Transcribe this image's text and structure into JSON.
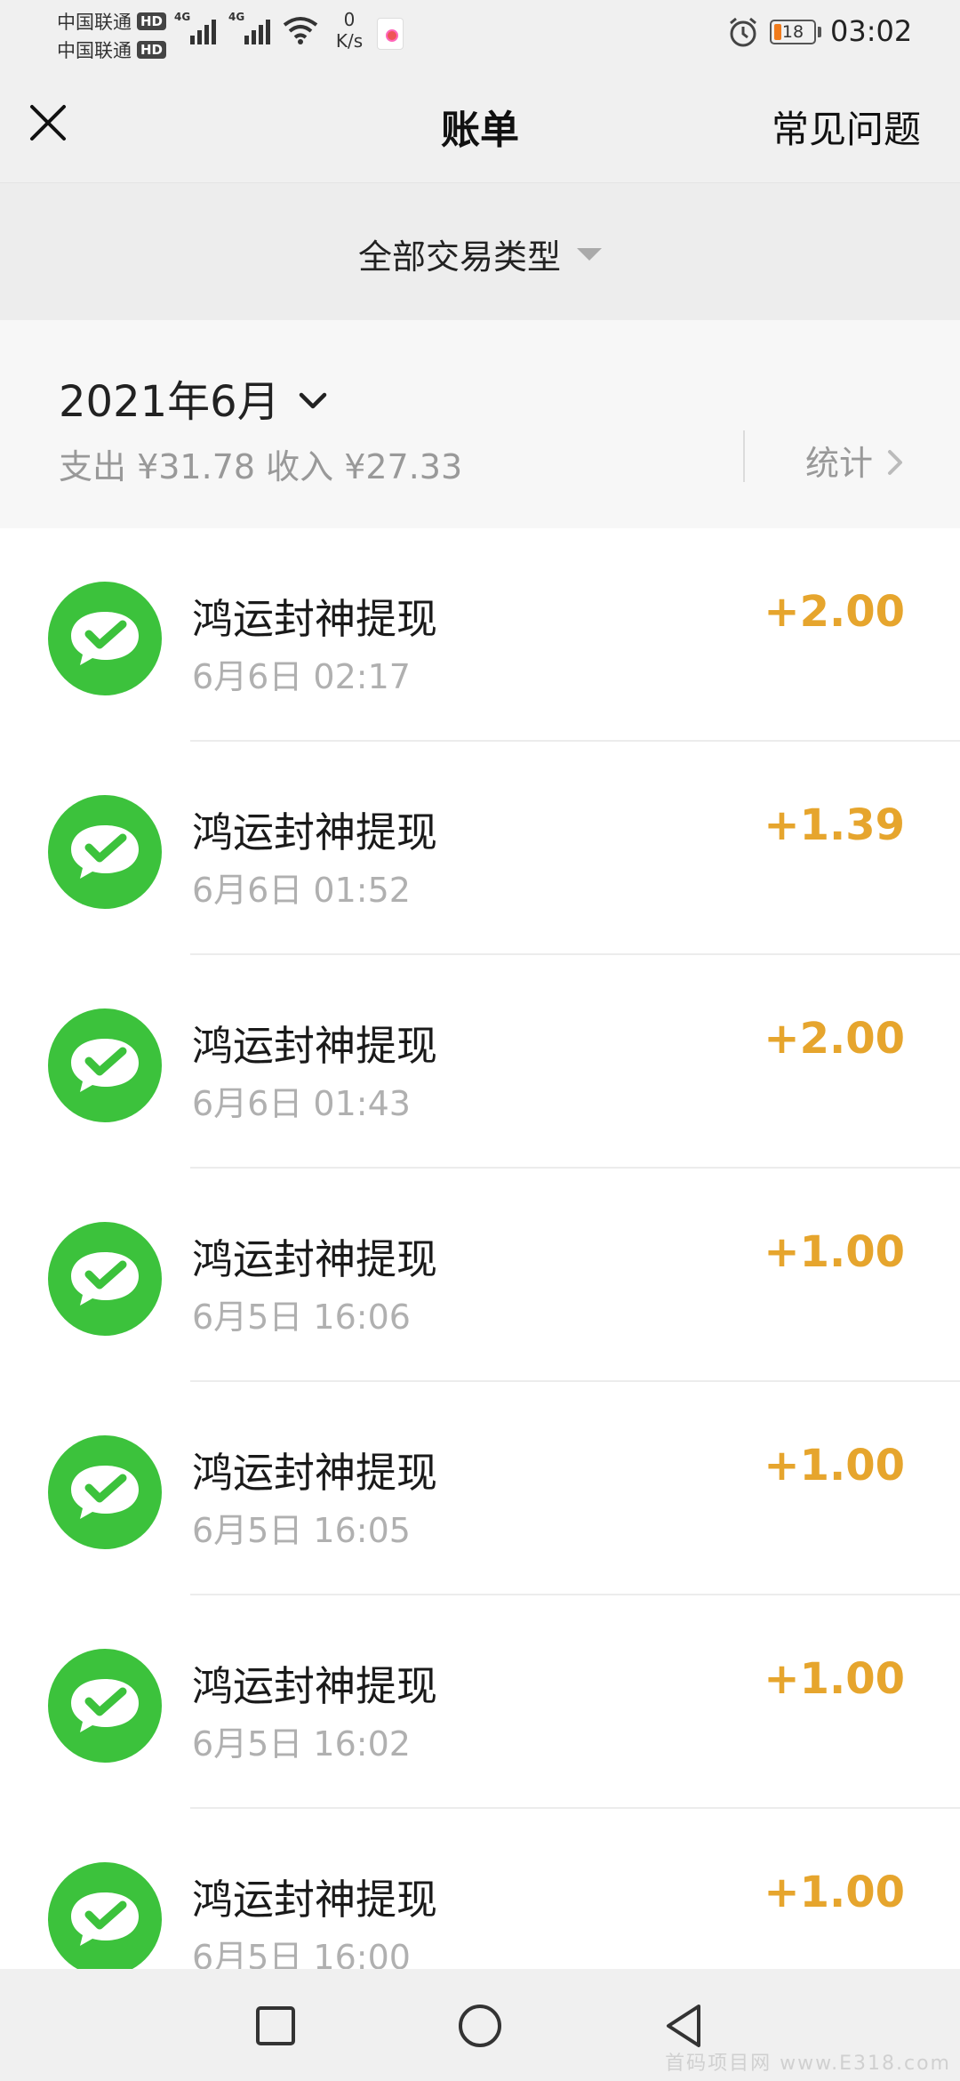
{
  "status_bar": {
    "carrier_1": "中国联通",
    "carrier_2": "中国联通",
    "hd_badge": "HD",
    "network_type": "4G",
    "net_speed_value": "0",
    "net_speed_unit": "K/s",
    "battery_level": "18",
    "battery_color": "#f07b1c",
    "time": "03:02"
  },
  "nav": {
    "title": "账单",
    "faq_label": "常见问题"
  },
  "filter": {
    "label": "全部交易类型"
  },
  "month": {
    "label": "2021年6月",
    "summary": "支出 ¥31.78 收入 ¥27.33",
    "stats_label": "统计"
  },
  "transactions": [
    {
      "title": "鸿运封神提现",
      "time": "6月6日 02:17",
      "amount": "+2.00",
      "icon": "wechat-pay-icon"
    },
    {
      "title": "鸿运封神提现",
      "time": "6月6日 01:52",
      "amount": "+1.39",
      "icon": "wechat-pay-icon"
    },
    {
      "title": "鸿运封神提现",
      "time": "6月6日 01:43",
      "amount": "+2.00",
      "icon": "wechat-pay-icon"
    },
    {
      "title": "鸿运封神提现",
      "time": "6月5日 16:06",
      "amount": "+1.00",
      "icon": "wechat-pay-icon"
    },
    {
      "title": "鸿运封神提现",
      "time": "6月5日 16:05",
      "amount": "+1.00",
      "icon": "wechat-pay-icon"
    },
    {
      "title": "鸿运封神提现",
      "time": "6月5日 16:02",
      "amount": "+1.00",
      "icon": "wechat-pay-icon"
    },
    {
      "title": "鸿运封神提现",
      "time": "6月5日 16:00",
      "amount": "+1.00",
      "icon": "wechat-pay-icon"
    }
  ],
  "colors": {
    "income_amount": "#e6a52d",
    "wechat_green": "#3cc23c"
  },
  "watermark": "首码项目网 www.E318.com"
}
